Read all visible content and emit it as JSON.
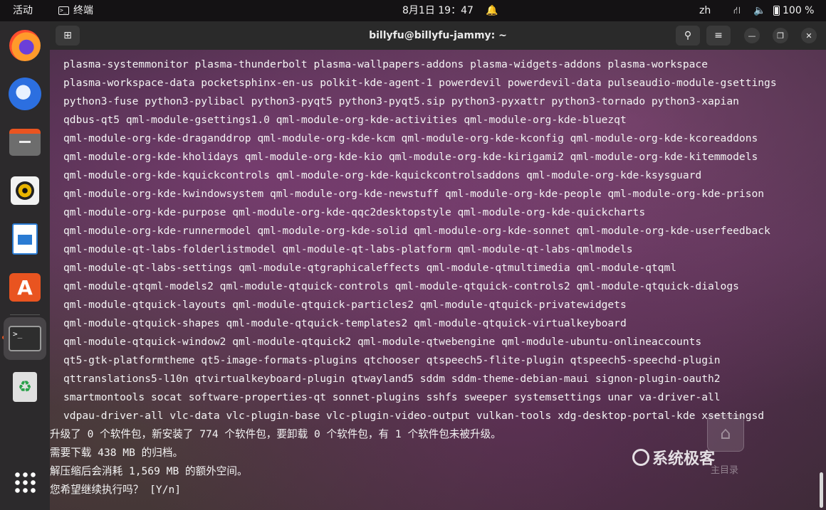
{
  "topbar": {
    "activities": "活动",
    "app_name": "终端",
    "app_glyph": ">_",
    "clock": "8月1日  19：47",
    "bell_glyph": "🔔",
    "language": "zh",
    "network_glyph": "⛙",
    "volume_glyph": "🔈",
    "battery": "100 %"
  },
  "dock": {
    "items": [
      {
        "name": "firefox",
        "icon": "firefox-icon"
      },
      {
        "name": "thunderbird",
        "icon": "thunderbird-icon"
      },
      {
        "name": "files",
        "icon": "files-icon"
      },
      {
        "name": "rhythmbox",
        "icon": "rhythmbox-icon"
      },
      {
        "name": "libreoffice-writer",
        "icon": "writer-icon"
      },
      {
        "name": "app-center",
        "icon": "app-store-icon"
      },
      {
        "name": "terminal",
        "icon": "terminal-icon",
        "running": true,
        "active": true
      },
      {
        "name": "trash",
        "icon": "trash-icon"
      },
      {
        "name": "show-applications",
        "icon": "app-grid-icon"
      }
    ],
    "appstore_glyph": "A",
    "terminal_glyph": ">_",
    "trash_glyph": "♻"
  },
  "window": {
    "title": "billyfu@billyfu-jammy: ~",
    "newtab_glyph": "⊞",
    "search_glyph": "⚲",
    "menu_glyph": "≡",
    "minimize_glyph": "—",
    "maximize_glyph": "❐",
    "close_glyph": "✕"
  },
  "terminal": {
    "package_lines": [
      "plasma-systemmonitor plasma-thunderbolt plasma-wallpapers-addons plasma-widgets-addons plasma-workspace",
      "plasma-workspace-data pocketsphinx-en-us polkit-kde-agent-1 powerdevil powerdevil-data pulseaudio-module-gsettings",
      "python3-fuse python3-pylibacl python3-pyqt5 python3-pyqt5.sip python3-pyxattr python3-tornado python3-xapian",
      "qdbus-qt5 qml-module-gsettings1.0 qml-module-org-kde-activities qml-module-org-kde-bluezqt",
      "qml-module-org-kde-draganddrop qml-module-org-kde-kcm qml-module-org-kde-kconfig qml-module-org-kde-kcoreaddons",
      "qml-module-org-kde-kholidays qml-module-org-kde-kio qml-module-org-kde-kirigami2 qml-module-org-kde-kitemmodels",
      "qml-module-org-kde-kquickcontrols qml-module-org-kde-kquickcontrolsaddons qml-module-org-kde-ksysguard",
      "qml-module-org-kde-kwindowsystem qml-module-org-kde-newstuff qml-module-org-kde-people qml-module-org-kde-prison",
      "qml-module-org-kde-purpose qml-module-org-kde-qqc2desktopstyle qml-module-org-kde-quickcharts",
      "qml-module-org-kde-runnermodel qml-module-org-kde-solid qml-module-org-kde-sonnet qml-module-org-kde-userfeedback",
      "qml-module-qt-labs-folderlistmodel qml-module-qt-labs-platform qml-module-qt-labs-qmlmodels",
      "qml-module-qt-labs-settings qml-module-qtgraphicaleffects qml-module-qtmultimedia qml-module-qtqml",
      "qml-module-qtqml-models2 qml-module-qtquick-controls qml-module-qtquick-controls2 qml-module-qtquick-dialogs",
      "qml-module-qtquick-layouts qml-module-qtquick-particles2 qml-module-qtquick-privatewidgets",
      "qml-module-qtquick-shapes qml-module-qtquick-templates2 qml-module-qtquick-virtualkeyboard",
      "qml-module-qtquick-window2 qml-module-qtquick2 qml-module-qtwebengine qml-module-ubuntu-onlineaccounts",
      "qt5-gtk-platformtheme qt5-image-formats-plugins qtchooser qtspeech5-flite-plugin qtspeech5-speechd-plugin",
      "qttranslations5-l10n qtvirtualkeyboard-plugin qtwayland5 sddm sddm-theme-debian-maui signon-plugin-oauth2",
      "smartmontools socat software-properties-qt sonnet-plugins sshfs sweeper systemsettings unar va-driver-all",
      "vdpau-driver-all vlc-data vlc-plugin-base vlc-plugin-video-output vulkan-tools xdg-desktop-portal-kde xsettingsd"
    ],
    "summary_lines": [
      "升级了 0 个软件包，新安装了 774 个软件包，要卸载 0 个软件包，有 1 个软件包未被升级。",
      "需要下载 438 MB 的归档。",
      "解压缩后会消耗 1,569 MB 的额外空间。",
      "您希望继续执行吗？ [Y/n]"
    ]
  },
  "watermark": {
    "home_glyph": "⌂",
    "home_label": "主目录",
    "brand": "系统极客"
  }
}
